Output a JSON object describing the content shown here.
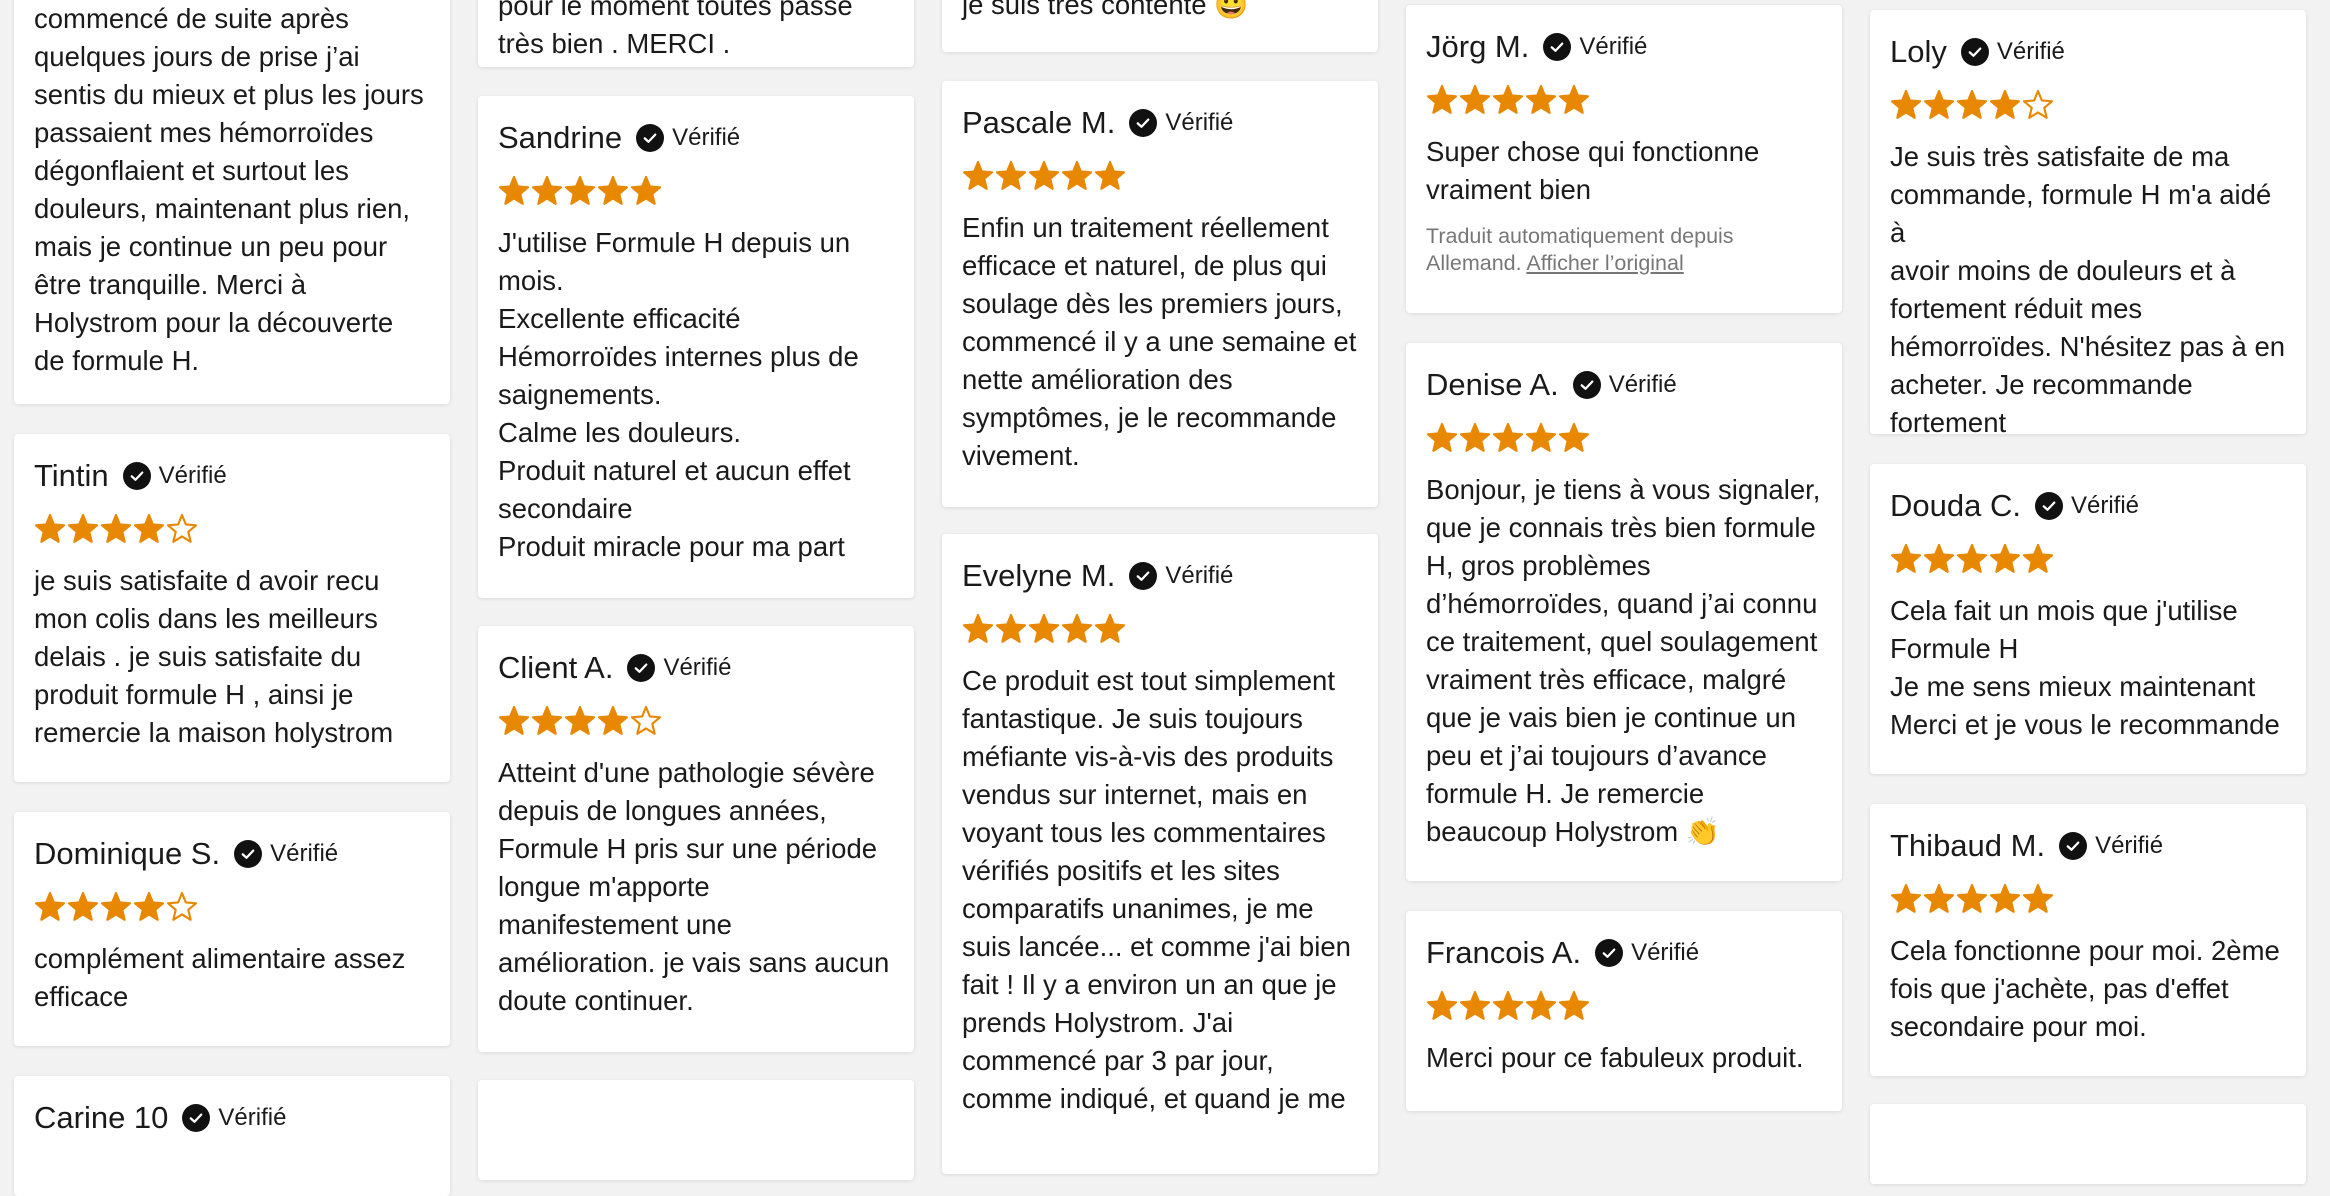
{
  "colors": {
    "star": "#e88800",
    "background": "#f2f2f2",
    "card": "#ffffff"
  },
  "verified_label": "Vérifié",
  "columns": [
    [
      {
        "name": "",
        "stars": 0,
        "lines": [
          "commencé de suite après",
          "quelques jours de prise j’ai",
          "sentis du mieux et plus les jours",
          "passaient mes hémorroïdes",
          "dégonflaient et surtout les",
          "douleurs, maintenant plus rien,",
          "mais je continue un peu pour",
          "être tranquille. Merci à",
          "Holystrom pour la découverte",
          "de formule H."
        ]
      },
      {
        "name": "Tintin",
        "stars": 4,
        "lines": [
          "je suis satisfaite d avoir recu",
          "mon colis dans les meilleurs",
          "delais . je suis satisfaite du",
          "produit formule H , ainsi je",
          "remercie la maison holystrom"
        ]
      },
      {
        "name": "Dominique S.",
        "stars": 4,
        "lines": [
          "complément alimentaire assez",
          "efficace"
        ]
      },
      {
        "name": "Carine 10",
        "stars": 0,
        "lines": []
      }
    ],
    [
      {
        "name": "",
        "stars": 0,
        "lines": [
          "pour le moment toutes passé",
          "très bien .  MERCI ."
        ]
      },
      {
        "name": "Sandrine",
        "stars": 5,
        "lines": [
          "J'utilise Formule H depuis un",
          "mois.",
          "Excellente efficacité",
          "Hémorroïdes internes plus de",
          "saignements.",
          "Calme les douleurs.",
          "Produit naturel et aucun effet",
          "secondaire",
          "Produit miracle pour ma part"
        ]
      },
      {
        "name": "Client A.",
        "stars": 4,
        "lines": [
          "Atteint d'une pathologie sévère",
          "depuis de longues années,",
          "Formule H pris sur une période",
          "longue m'apporte",
          "manifestement une",
          "amélioration. je vais sans aucun",
          "doute continuer."
        ]
      },
      {
        "name": "",
        "stars": 0,
        "lines": []
      }
    ],
    [
      {
        "name": "",
        "stars": 0,
        "lines": [
          "je suis très contente 😀"
        ]
      },
      {
        "name": "Pascale M.",
        "stars": 5,
        "lines": [
          "Enfin un traitement réellement",
          "efficace et naturel, de plus qui",
          "soulage dès les premiers jours,",
          "commencé il y a une semaine et",
          "nette amélioration des",
          "symptômes, je le recommande",
          "vivement."
        ]
      },
      {
        "name": "Evelyne M.",
        "stars": 5,
        "lines": [
          "Ce produit est tout simplement",
          "fantastique. Je suis toujours",
          "méfiante vis-à-vis des produits",
          "vendus sur internet, mais en",
          "voyant tous les commentaires",
          "vérifiés positifs et les sites",
          "comparatifs unanimes, je me",
          "suis lancée... et comme j'ai bien",
          "fait ! Il y a environ un an que je",
          "prends Holystrom. J'ai",
          "commencé par 3 par jour,",
          "comme indiqué, et quand je me"
        ]
      }
    ],
    [
      {
        "name": "Jörg M.",
        "stars": 5,
        "lines": [
          "Super chose qui fonctionne",
          "vraiment bien"
        ],
        "translated_note": "Traduit automatiquement depuis Allemand.",
        "translated_link": "Afficher l’original"
      },
      {
        "name": "Denise A.",
        "stars": 5,
        "lines": [
          "Bonjour, je tiens à vous signaler,",
          "que je connais très bien formule",
          "H, gros problèmes",
          "d’hémorroïdes, quand j’ai connu",
          "ce traitement, quel soulagement",
          "vraiment très efficace, malgré",
          "que je vais bien je continue un",
          "peu et j’ai toujours d’avance",
          "formule H. Je remercie",
          "beaucoup Holystrom 👏"
        ]
      },
      {
        "name": "Francois A.",
        "stars": 5,
        "lines": [
          "Merci pour ce fabuleux produit."
        ]
      }
    ],
    [
      {
        "name": "Loly",
        "stars": 4,
        "lines": [
          "Je suis très satisfaite de ma",
          "commande, formule H m'a aidé à",
          "avoir moins de douleurs et à",
          "fortement réduit mes",
          "hémorroïdes. N'hésitez pas à en",
          "acheter. Je recommande",
          "fortement"
        ]
      },
      {
        "name": "Douda C.",
        "stars": 5,
        "lines": [
          "Cela fait un mois que j'utilise",
          "Formule H",
          "Je me sens mieux maintenant",
          "Merci et je vous le recommande"
        ]
      },
      {
        "name": "Thibaud M.",
        "stars": 5,
        "lines": [
          "Cela fonctionne pour moi. 2ème",
          "fois que j'achète, pas d'effet",
          "secondaire pour moi."
        ]
      },
      {
        "name": "",
        "stars": 0,
        "lines": []
      }
    ]
  ]
}
